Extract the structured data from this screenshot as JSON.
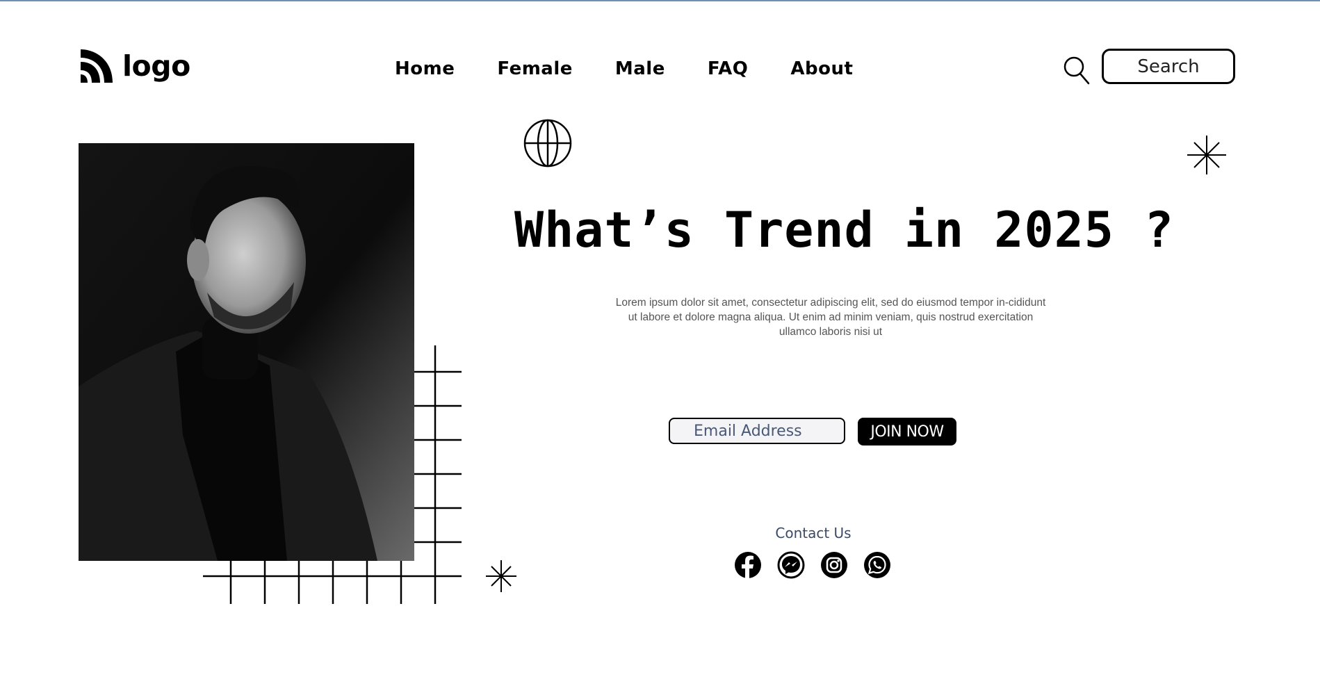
{
  "brand": {
    "logo_text": "logo"
  },
  "nav": {
    "items": [
      "Home",
      "Female",
      "Male",
      "FAQ",
      "About"
    ]
  },
  "search": {
    "label": "Search"
  },
  "hero": {
    "headline": "What’s Trend in 2025 ?",
    "lead": "Lorem ipsum dolor sit amet, consectetur adipiscing elit, sed do eiusmod tempor in-cididunt ut labore et dolore magna aliqua. Ut enim ad minim veniam, quis nostrud exercitation ullamco laboris nisi ut",
    "email_placeholder": "Email Address",
    "join_label": "JOIN NOW"
  },
  "contact": {
    "label": "Contact Us",
    "socials": [
      "facebook-icon",
      "messenger-icon",
      "instagram-icon",
      "whatsapp-icon"
    ]
  },
  "colors": {
    "accent": "#000000",
    "muted_text": "#555555",
    "contact_text": "#3a4a66",
    "top_rule": "#6f8fb3"
  }
}
